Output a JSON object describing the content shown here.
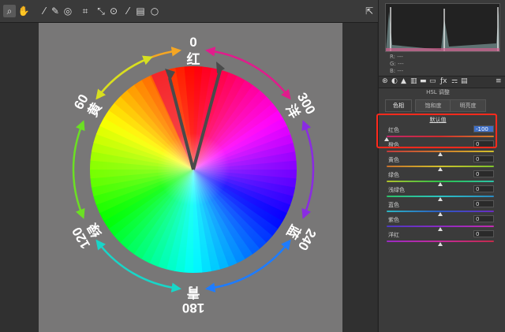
{
  "toolbar": {
    "tools": [
      {
        "icon": "zoom-icon",
        "glyph": "⌕",
        "active": true
      },
      {
        "icon": "hand-icon",
        "glyph": "✋"
      },
      {
        "icon": "white-balance-icon",
        "glyph": "⁄"
      },
      {
        "icon": "color-sampler-icon",
        "glyph": "✎"
      },
      {
        "icon": "targeted-adjust-icon",
        "glyph": "◎"
      },
      {
        "icon": "crop-icon",
        "glyph": "⌗"
      },
      {
        "icon": "straighten-icon",
        "glyph": "⤡"
      },
      {
        "icon": "red-eye-icon",
        "glyph": "⊙"
      },
      {
        "icon": "brush-icon",
        "glyph": "⁄"
      },
      {
        "icon": "graduated-filter-icon",
        "glyph": "▤"
      },
      {
        "icon": "radial-filter-icon",
        "glyph": "○"
      }
    ],
    "export_icon": "export-icon"
  },
  "wheel": {
    "labels": {
      "red_char": "红",
      "red_deg": "0",
      "magenta_char": "洋",
      "magenta_deg": "300",
      "blue_char": "蓝",
      "blue_deg": "240",
      "cyan_char": "青",
      "cyan_deg": "180",
      "green_char": "绿",
      "green_deg": "120",
      "yellow_char": "黄",
      "yellow_deg": "60"
    }
  },
  "panel": {
    "histogram_rgb": {
      "r": "R:",
      "g": "G:",
      "b": "B:",
      "dash": "---"
    },
    "title": "HSL 调整",
    "subtabs": [
      "色相",
      "饱和度",
      "明亮度"
    ],
    "default_link": "默认值",
    "sliders": [
      {
        "label": "红色",
        "value": "-100",
        "level": 0.0,
        "selected": true,
        "track": "linear-gradient(90deg,#c0266a,#d12d2d,#d0802b)"
      },
      {
        "label": "橙色",
        "value": "0",
        "level": 0.5,
        "track": "linear-gradient(90deg,#c23b3b,#d07a2b,#d0c02b)"
      },
      {
        "label": "黄色",
        "value": "0",
        "level": 0.5,
        "track": "linear-gradient(90deg,#c8702b,#cfc02b,#7ec42b)"
      },
      {
        "label": "绿色",
        "value": "0",
        "level": 0.5,
        "track": "linear-gradient(90deg,#b0c22b,#2bc24a,#2bc2a8)"
      },
      {
        "label": "浅绿色",
        "value": "0",
        "level": 0.5,
        "track": "linear-gradient(90deg,#2bc26a,#2bc2c2,#2b8ac2)"
      },
      {
        "label": "蓝色",
        "value": "0",
        "level": 0.5,
        "track": "linear-gradient(90deg,#2bb6c2,#2b5ac2,#6a2bc2)"
      },
      {
        "label": "紫色",
        "value": "0",
        "level": 0.5,
        "track": "linear-gradient(90deg,#4a3ac2,#8a2bc2,#c22bb0)"
      },
      {
        "label": "洋红",
        "value": "0",
        "level": 0.5,
        "track": "linear-gradient(90deg,#9a2bc2,#c22b9a,#c22b4a)"
      }
    ]
  }
}
